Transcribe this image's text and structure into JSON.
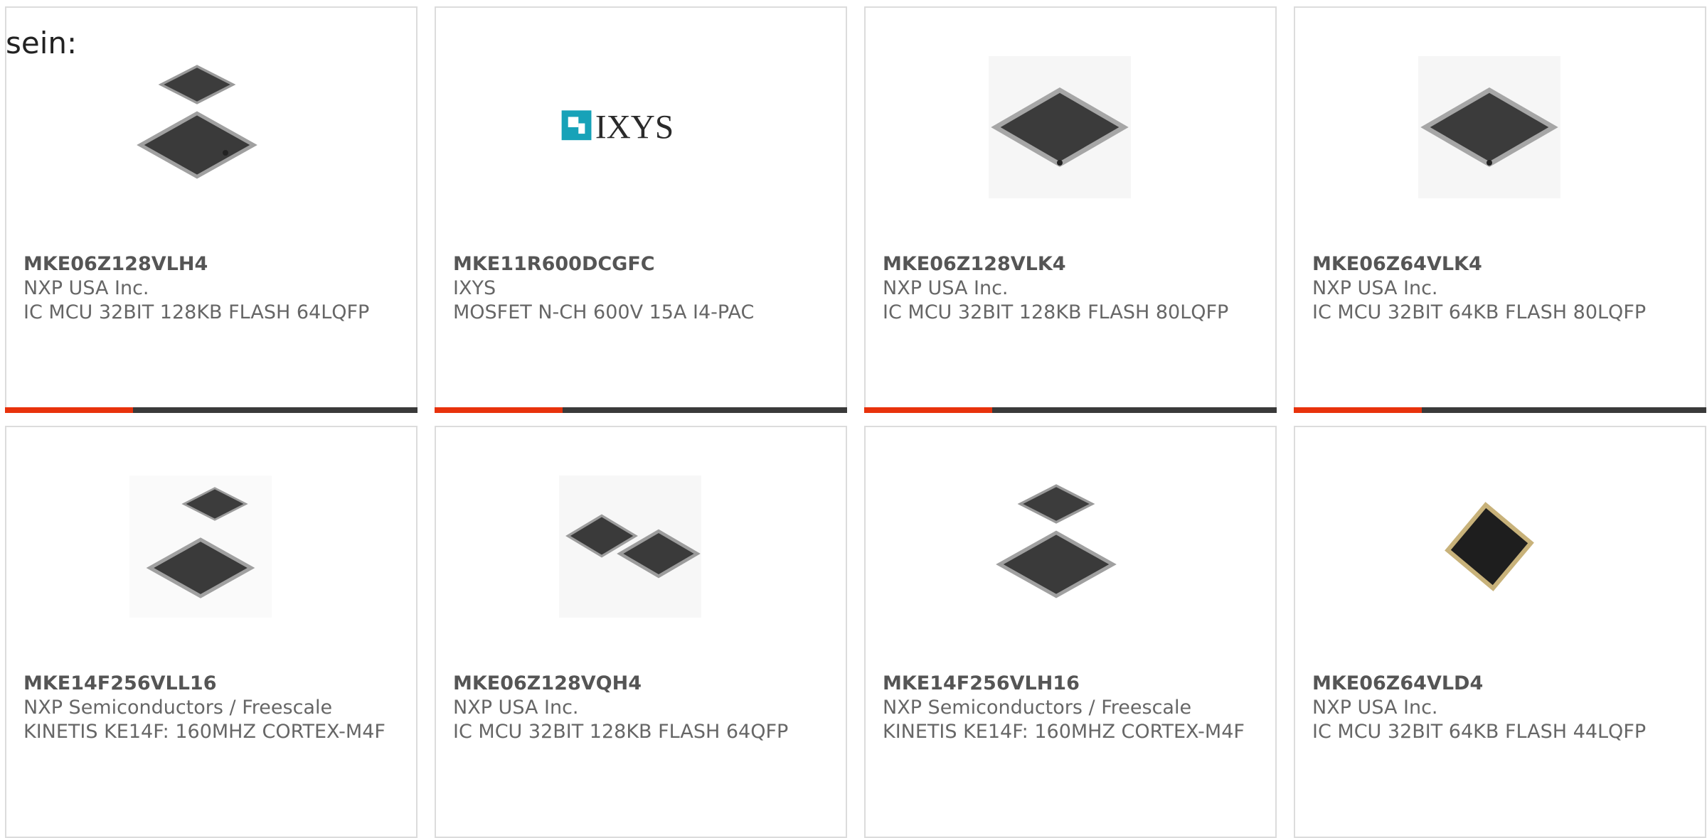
{
  "intro_text": "sein:",
  "colors": {
    "accent": "#e8320c",
    "bar_track": "#3a3a3a",
    "card_border": "#dcdcdc",
    "logo_teal": "#17a2b8"
  },
  "products": [
    {
      "part_number": "MKE06Z128VLH4",
      "manufacturer": "NXP USA Inc.",
      "description": "IC MCU 32BIT 128KB FLASH 64LQFP",
      "image": "ic-two-qfp-stacked-icon",
      "accent_fraction": 0.31
    },
    {
      "part_number": "MKE11R600DCGFC",
      "manufacturer": "IXYS",
      "description": "MOSFET N-CH 600V 15A I4-PAC",
      "image": "ixys-logo",
      "logo_text": "IXYS",
      "accent_fraction": 0.31
    },
    {
      "part_number": "MKE06Z128VLK4",
      "manufacturer": "NXP USA Inc.",
      "description": "IC MCU 32BIT 128KB FLASH 80LQFP",
      "image": "ic-qfp-single-icon",
      "accent_fraction": 0.31
    },
    {
      "part_number": "MKE06Z64VLK4",
      "manufacturer": "NXP USA Inc.",
      "description": "IC MCU 32BIT 64KB FLASH 80LQFP",
      "image": "ic-qfp-single-icon",
      "accent_fraction": 0.31
    },
    {
      "part_number": "MKE14F256VLL16",
      "manufacturer": "NXP Semiconductors / Freescale",
      "description": "KINETIS KE14F: 160MHZ CORTEX-M4F",
      "image": "ic-two-qfp-stacked-icon",
      "accent_fraction": 0
    },
    {
      "part_number": "MKE06Z128VQH4",
      "manufacturer": "NXP USA Inc.",
      "description": "IC MCU 32BIT 128KB FLASH 64QFP",
      "image": "ic-two-qfp-side-icon",
      "accent_fraction": 0
    },
    {
      "part_number": "MKE14F256VLH16",
      "manufacturer": "NXP Semiconductors / Freescale",
      "description": "KINETIS KE14F: 160MHZ CORTEX-M4F",
      "image": "ic-two-qfp-stacked-icon",
      "accent_fraction": 0
    },
    {
      "part_number": "MKE06Z64VLD4",
      "manufacturer": "NXP USA Inc.",
      "description": "IC MCU 32BIT 64KB FLASH 44LQFP",
      "image": "ic-lqfp-small-icon",
      "accent_fraction": 0
    }
  ]
}
